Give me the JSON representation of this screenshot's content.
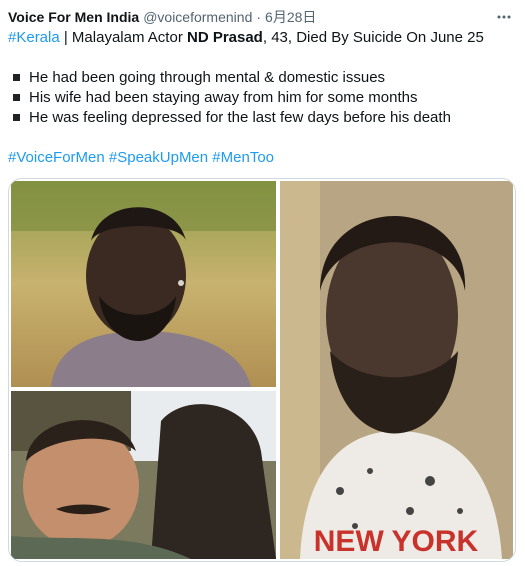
{
  "tweet": {
    "display_name": "Voice For Men India",
    "handle": "@voiceformenind",
    "separator": "·",
    "date": "6月28日",
    "more_icon": "more-horizontal-icon",
    "line1": {
      "hashtag": "#Kerala",
      "text_a": " | Malayalam Actor ",
      "bold": "ND Prasad",
      "text_b": ", 43, Died By Suicide On June 25"
    },
    "bullets": [
      "He had been going through mental & domestic issues",
      "His wife had been staying away from him for some months",
      "He was feeling depressed for the last few days before his death"
    ],
    "hashtags": [
      "#VoiceForMen",
      "#SpeakUpMen",
      "#MenToo"
    ],
    "media": {
      "shirt_text": "NEW YORK"
    }
  },
  "colors": {
    "link": "#1d9bf0",
    "text": "#0f1419",
    "secondary": "#536471",
    "border": "#cfd9de"
  }
}
